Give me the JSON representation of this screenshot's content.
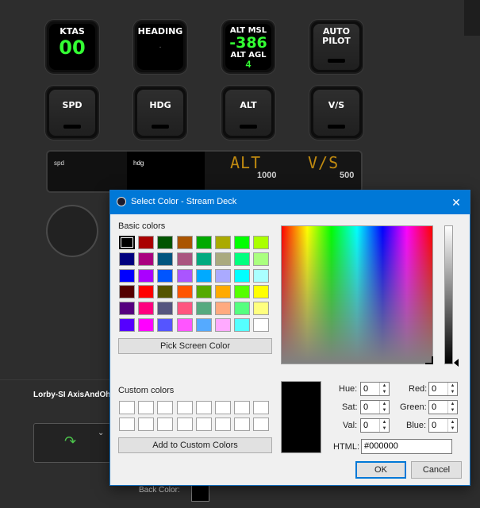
{
  "keys": {
    "ktas": {
      "title": "KTAS",
      "value": "00"
    },
    "heading": {
      "title": "HEADING",
      "value": "."
    },
    "alt": {
      "title1": "ALT MSL",
      "value1": "-386",
      "title2": "ALT AGL",
      "value2": "4"
    },
    "autopilot": {
      "line1": "AUTO",
      "line2": "PILOT"
    },
    "spd": {
      "label": "SPD"
    },
    "hdg": {
      "label": "HDG"
    },
    "altbtn": {
      "label": "ALT"
    },
    "vs": {
      "label": "V/S"
    }
  },
  "strip": {
    "seg1_label": "spd",
    "seg2_label": "hdg",
    "seg3_lcd": "ALT",
    "seg3_value": "1000",
    "seg4_lcd": "V/S",
    "seg4_value": "500"
  },
  "lower": {
    "plugin_name": "Lorby-SI AxisAndOh",
    "back_color_label": "Back Color:"
  },
  "dialog": {
    "title": "Select Color - Stream Deck",
    "basic_colors_label": "Basic colors",
    "custom_colors_label": "Custom colors",
    "pick_screen_button": "Pick Screen Color",
    "add_custom_button": "Add to Custom Colors",
    "hue_label": "Hue:",
    "hue": "0",
    "sat_label": "Sat:",
    "sat": "0",
    "val_label": "Val:",
    "val": "0",
    "red_label": "Red:",
    "red": "0",
    "green_label": "Green:",
    "green": "0",
    "blue_label": "Blue:",
    "blue": "0",
    "html_label": "HTML:",
    "html_value": "#000000",
    "ok_button": "OK",
    "cancel_button": "Cancel",
    "basic_colors": [
      "#000000",
      "#aa0000",
      "#005500",
      "#aa5500",
      "#00aa00",
      "#aaaa00",
      "#00ff00",
      "#aaff00",
      "#00007f",
      "#aa007f",
      "#00557f",
      "#aa557f",
      "#00aa7f",
      "#aaaa7f",
      "#00ff7f",
      "#aaff7f",
      "#0000ff",
      "#aa00ff",
      "#0055ff",
      "#aa55ff",
      "#00aaff",
      "#aaaaff",
      "#00ffff",
      "#aaffff",
      "#550000",
      "#ff0000",
      "#555500",
      "#ff5500",
      "#55aa00",
      "#ffaa00",
      "#55ff00",
      "#ffff00",
      "#55007f",
      "#ff007f",
      "#55557f",
      "#ff557f",
      "#55aa7f",
      "#ffaa7f",
      "#55ff7f",
      "#ffff7f",
      "#5500ff",
      "#ff00ff",
      "#5555ff",
      "#ff55ff",
      "#55aaff",
      "#ffaaff",
      "#55ffff",
      "#ffffff"
    ],
    "selected_color": "#000000"
  }
}
